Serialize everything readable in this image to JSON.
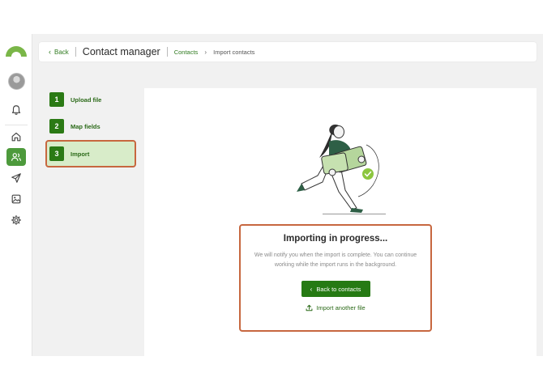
{
  "header": {
    "back_label": "Back",
    "title": "Contact manager",
    "breadcrumb": {
      "link": "Contacts",
      "current": "Import contacts"
    }
  },
  "sidebar": {
    "items": [
      {
        "icon": "bell-icon"
      },
      {
        "icon": "home-icon"
      },
      {
        "icon": "contacts-icon",
        "active": true
      },
      {
        "icon": "send-icon"
      },
      {
        "icon": "image-icon"
      },
      {
        "icon": "settings-icon"
      }
    ]
  },
  "steps": [
    {
      "number": "1",
      "label": "Upload file"
    },
    {
      "number": "2",
      "label": "Map fields"
    },
    {
      "number": "3",
      "label": "Import",
      "active": true
    }
  ],
  "status": {
    "title": "Importing in progress...",
    "message": "We will notify you when the import is complete. You can continue working while the import runs in the background.",
    "primary_button": "Back to contacts",
    "secondary_link": "Import another file"
  },
  "colors": {
    "brand_green": "#267a14",
    "active_step_bg": "#d8ecc9",
    "highlight_border": "#c7673f",
    "logo_green": "#7ab648"
  }
}
